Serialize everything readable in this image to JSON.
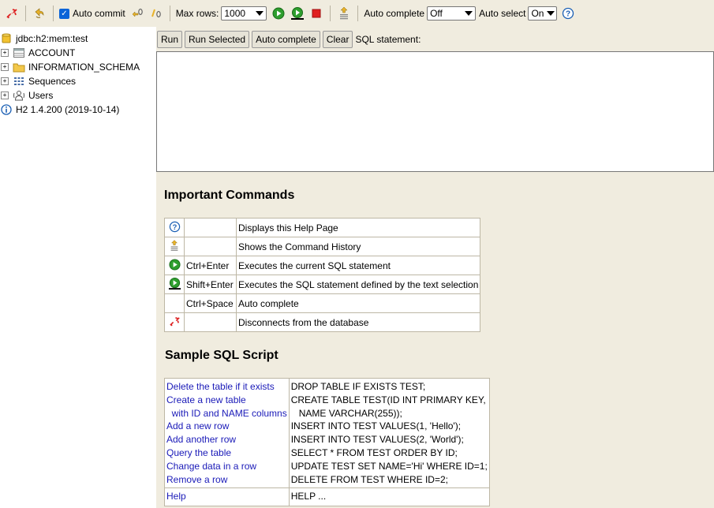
{
  "toolbar": {
    "auto_commit_label": "Auto commit",
    "max_rows_label": "Max rows:",
    "max_rows_value": "1000",
    "auto_complete_label": "Auto complete",
    "auto_complete_value": "Off",
    "auto_select_label": "Auto select",
    "auto_select_value": "On",
    "help_glyph": "?"
  },
  "tree": {
    "connection": "jdbc:h2:mem:test",
    "items": [
      {
        "label": "ACCOUNT",
        "icon": "table-icon"
      },
      {
        "label": "INFORMATION_SCHEMA",
        "icon": "folder-icon"
      },
      {
        "label": "Sequences",
        "icon": "sequences-icon"
      },
      {
        "label": "Users",
        "icon": "users-icon"
      }
    ],
    "version": "H2 1.4.200 (2019-10-14)"
  },
  "sql": {
    "run": "Run",
    "run_selected": "Run Selected",
    "auto_complete": "Auto complete",
    "clear": "Clear",
    "statement_label": "SQL statement:"
  },
  "commands": {
    "title": "Important Commands",
    "rows": [
      {
        "icon": "help-icon",
        "key": "",
        "desc": "Displays this Help Page"
      },
      {
        "icon": "history-icon",
        "key": "",
        "desc": "Shows the Command History"
      },
      {
        "icon": "run-icon",
        "key": "Ctrl+Enter",
        "desc": "Executes the current SQL statement"
      },
      {
        "icon": "run-selected-icon",
        "key": "Shift+Enter",
        "desc": "Executes the SQL statement defined by the text selection"
      },
      {
        "icon": "",
        "key": "Ctrl+Space",
        "desc": "Auto complete"
      },
      {
        "icon": "disconnect-icon",
        "key": "",
        "desc": "Disconnects from the database"
      }
    ]
  },
  "sample": {
    "title": "Sample SQL Script",
    "left": [
      "Delete the table if it exists",
      "Create a new table",
      "  with ID and NAME columns",
      "Add a new row",
      "Add another row",
      "Query the table",
      "Change data in a row",
      "Remove a row"
    ],
    "right": [
      "DROP TABLE IF EXISTS TEST;",
      "CREATE TABLE TEST(ID INT PRIMARY KEY,",
      "   NAME VARCHAR(255));",
      "INSERT INTO TEST VALUES(1, 'Hello');",
      "INSERT INTO TEST VALUES(2, 'World');",
      "SELECT * FROM TEST ORDER BY ID;",
      "UPDATE TEST SET NAME='Hi' WHERE ID=1;",
      "DELETE FROM TEST WHERE ID=2;"
    ],
    "help_left": "Help",
    "help_right": "HELP ..."
  },
  "colors": {
    "panel_bg": "#f0ecdf",
    "link": "#1a1ab8",
    "run_green": "#2e9e2e",
    "stop_red": "#e02020",
    "help_blue": "#1a5fb4"
  }
}
